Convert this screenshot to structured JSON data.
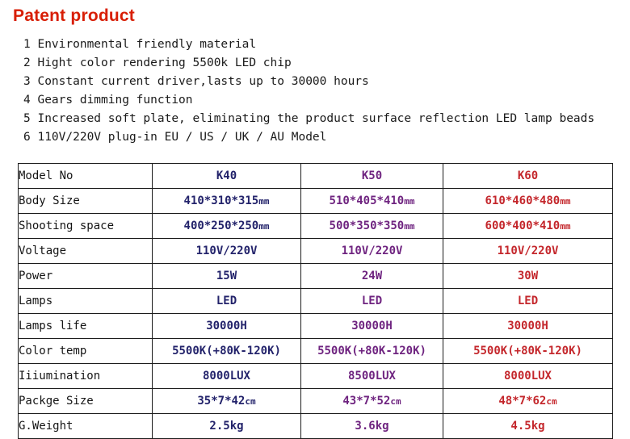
{
  "title": "Patent product",
  "colors": {
    "title_red": "#d81e05",
    "k40": "#23236b",
    "k50": "#6f2480",
    "k60": "#c4272c",
    "border": "#1c1c1c",
    "text": "#141414"
  },
  "features": [
    "1 Environmental friendly material",
    "2 Hight color rendering 5500k LED chip",
    "3 Constant current driver,lasts up to 30000 hours",
    "4 Gears dimming function",
    "5 Increased soft plate, eliminating the product surface reflection LED lamp beads",
    "6 110V/220V  plug-in EU / US / UK / AU  Model"
  ],
  "table": {
    "columns": [
      "",
      "K40",
      "K50",
      "K60"
    ],
    "rows": [
      {
        "label": "Model No",
        "k40": "K40",
        "k50": "K50",
        "k60": "K60"
      },
      {
        "label": "Body Size",
        "k40": "410*310*315mm",
        "k50": "510*405*410mm",
        "k60": "610*460*480mm"
      },
      {
        "label": "Shooting space",
        "k40": "400*250*250mm",
        "k50": "500*350*350mm",
        "k60": "600*400*410mm"
      },
      {
        "label": "Voltage",
        "k40": "110V/220V",
        "k50": "110V/220V",
        "k60": "110V/220V"
      },
      {
        "label": "Power",
        "k40": "15W",
        "k50": "24W",
        "k60": "30W"
      },
      {
        "label": "Lamps",
        "k40": "LED",
        "k50": "LED",
        "k60": "LED"
      },
      {
        "label": "Lamps life",
        "k40": "30000H",
        "k50": "30000H",
        "k60": "30000H"
      },
      {
        "label": "Color temp",
        "k40": "5500K(+80K-120K)",
        "k50": "5500K(+80K-120K)",
        "k60": "5500K(+80K-120K)"
      },
      {
        "label": "Iiiumination",
        "k40": "8000LUX",
        "k50": "8500LUX",
        "k60": "8000LUX"
      },
      {
        "label": "Packge Size",
        "k40": "35*7*42cm",
        "k50": "43*7*52cm",
        "k60": "48*7*62cm"
      },
      {
        "label": "G.Weight",
        "k40": "2.5kg",
        "k50": "3.6kg",
        "k60": "4.5kg"
      }
    ]
  }
}
